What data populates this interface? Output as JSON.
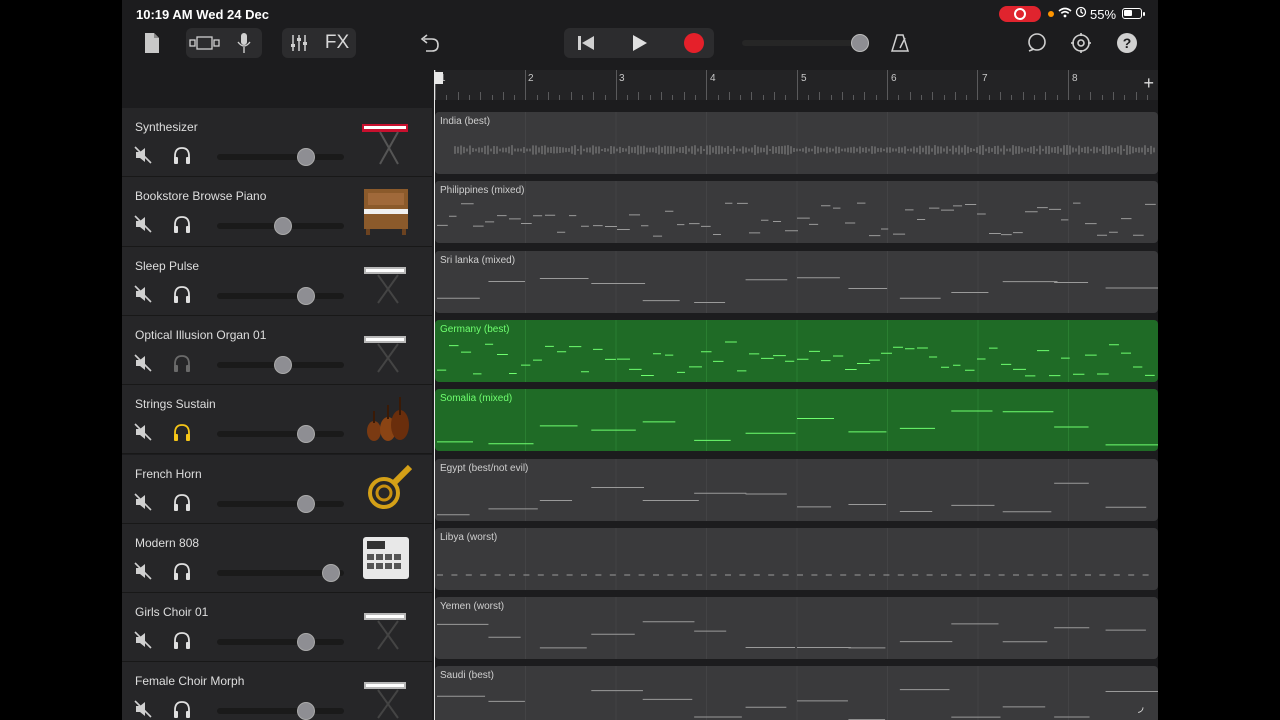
{
  "status": {
    "time": "10:19 AM",
    "date": "Wed 24 Dec",
    "battery": "55%"
  },
  "toolbar": {
    "fx_label": "FX"
  },
  "ruler": {
    "bars": [
      "1",
      "2",
      "3",
      "4",
      "5",
      "6",
      "7",
      "8"
    ],
    "add": "+"
  },
  "tracks": [
    {
      "name": "Synthesizer",
      "volume": 0.7,
      "solo_active": false,
      "instrument": "red-keyboard-icon",
      "region": "India (best)",
      "green": false
    },
    {
      "name": "Bookstore Browse Piano",
      "volume": 0.52,
      "solo_active": false,
      "instrument": "upright-piano-icon",
      "region": "Philippines (mixed)",
      "green": false
    },
    {
      "name": "Sleep Pulse",
      "volume": 0.7,
      "solo_active": false,
      "instrument": "keyboard-stand-icon",
      "region": "Sri lanka (mixed)",
      "green": false
    },
    {
      "name": "Optical Illusion Organ 01",
      "volume": 0.52,
      "solo_active": false,
      "solo_dimmed": true,
      "instrument": "keyboard-stand-icon",
      "region": "Germany (best)",
      "green": true
    },
    {
      "name": "Strings Sustain",
      "volume": 0.7,
      "solo_active": true,
      "instrument": "strings-icon",
      "region": "Somalia (mixed)",
      "green": true
    },
    {
      "name": "French Horn",
      "volume": 0.7,
      "solo_active": false,
      "instrument": "french-horn-icon",
      "region": "Egypt (best/not evil)",
      "green": false
    },
    {
      "name": "Modern 808",
      "volume": 0.9,
      "solo_active": false,
      "instrument": "drum-machine-icon",
      "region": "Libya (worst)",
      "green": false
    },
    {
      "name": "Girls Choir 01",
      "volume": 0.7,
      "solo_active": false,
      "instrument": "keyboard-stand-icon",
      "region": "Yemen (worst)",
      "green": false
    },
    {
      "name": "Female Choir Morph",
      "volume": 0.7,
      "solo_active": false,
      "instrument": "keyboard-stand-icon",
      "region": "Saudi (best)",
      "green": false
    }
  ],
  "colors": {
    "record": "#e5202a",
    "green_region": "#1f6b26",
    "green_note": "#6fff6f",
    "solo_active": "#f5c518"
  }
}
